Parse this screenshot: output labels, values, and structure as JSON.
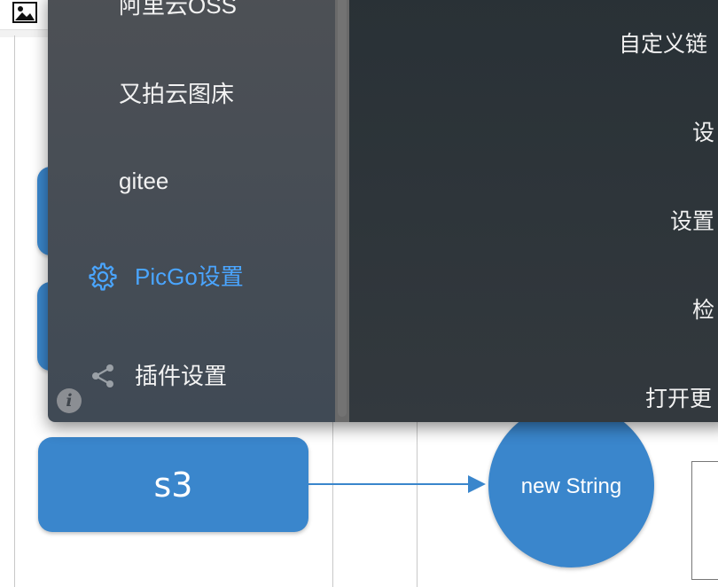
{
  "picgo": {
    "menu": [
      {
        "id": "aliyun",
        "label": "阿里云OSS"
      },
      {
        "id": "upyun",
        "label": "又拍云图床"
      },
      {
        "id": "gitee",
        "label": "gitee"
      },
      {
        "id": "picgo-settings",
        "label": "PicGo设置",
        "active": true,
        "icon": "gear-icon"
      },
      {
        "id": "plugin-settings",
        "label": "插件设置",
        "icon": "share-icon"
      }
    ],
    "info_icon": "i",
    "settings_labels": [
      "自定义链",
      "设",
      "设置",
      "检",
      "打开更"
    ]
  },
  "diagram": {
    "node_s3": "s3",
    "node_circle": "new String"
  },
  "colors": {
    "active": "#4aa5ff",
    "node_blue": "#3a86cc",
    "sidebar_bg": "#454b52",
    "content_bg": "#2c3338"
  }
}
